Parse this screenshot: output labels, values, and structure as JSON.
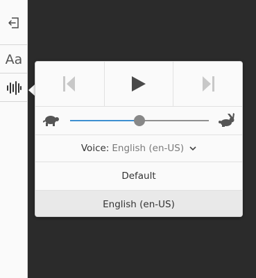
{
  "sidebar": {
    "font_button_label": "Aa"
  },
  "tts": {
    "voice_label": "Voice:",
    "voice_value": "English (en-US)",
    "rate_fraction": 0.5,
    "voices": [
      {
        "label": "Default",
        "selected": false
      },
      {
        "label": "English (en-US)",
        "selected": true
      }
    ]
  },
  "colors": {
    "accent": "#3d8fd1"
  },
  "icons": {
    "back": "exit-reader-icon",
    "previous": "skip-previous-icon",
    "play": "play-icon",
    "next": "skip-next-icon",
    "slow": "turtle-icon",
    "fast": "rabbit-icon",
    "speech": "speech-waveform-icon"
  }
}
